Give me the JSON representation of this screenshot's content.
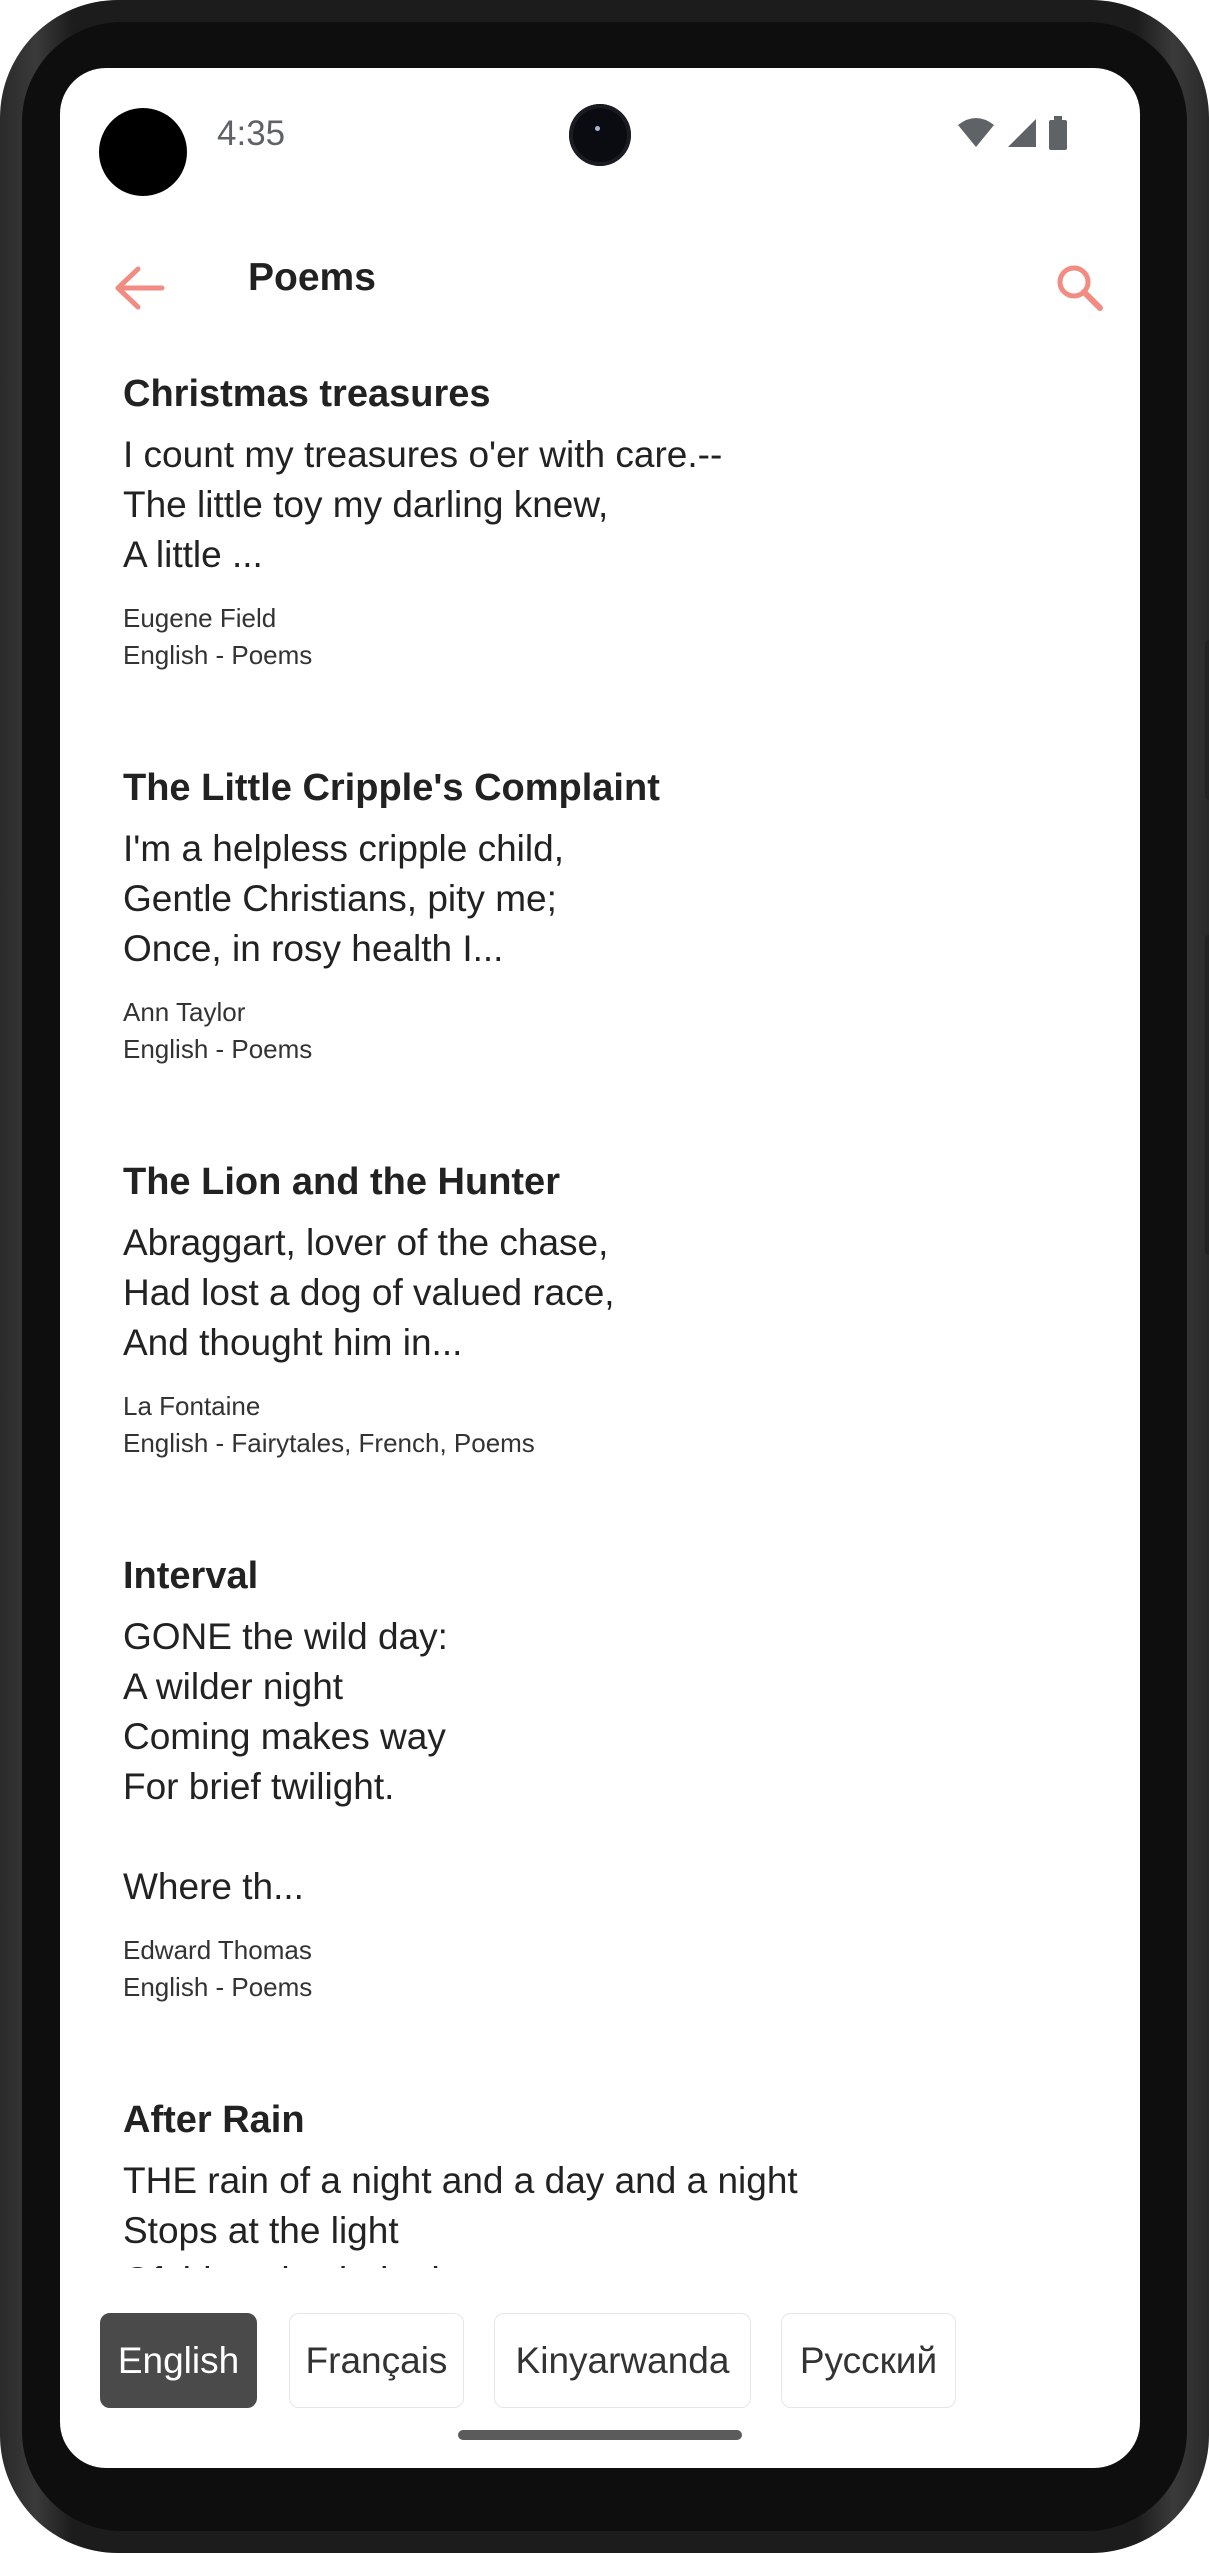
{
  "status_bar": {
    "time": "4:35"
  },
  "app_bar": {
    "title": "Poems",
    "back_icon": "arrow-back-icon",
    "search_icon": "search-icon"
  },
  "accent_color": "#f28b82",
  "poems": [
    {
      "title": "Christmas treasures",
      "excerpt": "I count my treasures o'er with care.--\nThe little toy my darling knew,\nA little ...",
      "author": "Eugene Field",
      "tags": "English - Poems"
    },
    {
      "title": "The Little Cripple's Complaint",
      "excerpt": "I'm a helpless cripple child,\nGentle Christians, pity me;\nOnce, in rosy health I...",
      "author": "Ann Taylor",
      "tags": "English - Poems"
    },
    {
      "title": "The Lion and the Hunter",
      "excerpt": "Abraggart, lover of the chase,\nHad lost a dog of valued race,\nAnd thought him in...",
      "author": "La Fontaine",
      "tags": "English - Fairytales, French, Poems"
    },
    {
      "title": "Interval",
      "excerpt": "GONE the wild day:\nA wilder night\nComing makes way\nFor brief twilight.\n\nWhere th...",
      "author": "Edward Thomas",
      "tags": "English - Poems"
    },
    {
      "title": "After Rain",
      "excerpt": "THE rain of a night and a day and a night\nStops at the light\nOf this pale choked",
      "author": "",
      "tags": ""
    }
  ],
  "languages": [
    {
      "label": "English",
      "active": true
    },
    {
      "label": "Français",
      "active": false
    },
    {
      "label": "Kinyarwanda",
      "active": false
    },
    {
      "label": "Русский",
      "active": false
    }
  ]
}
